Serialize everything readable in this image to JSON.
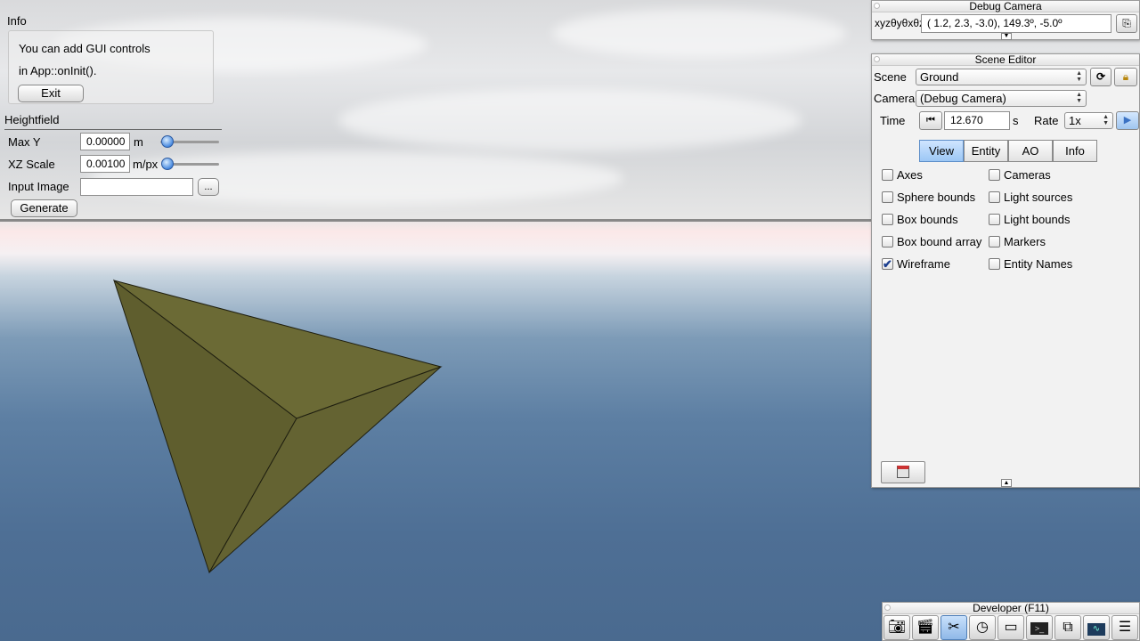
{
  "info_panel": {
    "title": "Info",
    "line1": "You can add GUI controls",
    "line2": "in App::onInit().",
    "exit_label": "Exit"
  },
  "heightfield_panel": {
    "title": "Heightfield",
    "max_y_label": "Max Y",
    "max_y_value": "0.00000",
    "max_y_unit": "m",
    "xz_scale_label": "XZ Scale",
    "xz_scale_value": "0.00100",
    "xz_scale_unit": "m/px",
    "input_image_label": "Input Image",
    "input_image_value": "",
    "browse_label": "...",
    "generate_label": "Generate"
  },
  "debug_camera": {
    "title": "Debug Camera",
    "coord_label": "xyzθyθxθz",
    "coord_value": "(  1.2,   2.3,  -3.0),  149.3º,  -5.0º"
  },
  "scene_editor": {
    "title": "Scene Editor",
    "scene_label": "Scene",
    "scene_value": "Ground",
    "camera_label": "Camera",
    "camera_value": "(Debug Camera)",
    "time_label": "Time",
    "time_value": "12.670",
    "time_unit": "s",
    "rate_label": "Rate",
    "rate_value": "1x",
    "tabs": [
      "View",
      "Entity",
      "AO",
      "Info"
    ],
    "active_tab": "View",
    "checkboxes_left": [
      {
        "label": "Axes",
        "checked": false
      },
      {
        "label": "Sphere bounds",
        "checked": false
      },
      {
        "label": "Box bounds",
        "checked": false
      },
      {
        "label": "Box bound array",
        "checked": false
      },
      {
        "label": "Wireframe",
        "checked": true
      }
    ],
    "checkboxes_right": [
      {
        "label": "Cameras",
        "checked": false
      },
      {
        "label": "Light sources",
        "checked": false
      },
      {
        "label": "Light bounds",
        "checked": false
      },
      {
        "label": "Markers",
        "checked": false
      },
      {
        "label": "Entity Names",
        "checked": false
      }
    ]
  },
  "developer": {
    "title": "Developer (F11)",
    "icons": [
      "camera-icon",
      "clapperboard-icon",
      "tools-icon",
      "clock-icon",
      "window-new-icon",
      "terminal-icon",
      "scene-windows-icon",
      "profiler-icon",
      "log-icon"
    ]
  },
  "colors": {
    "tetrahedron": "#6b6a35",
    "tab_active": "#9cc7f5",
    "sky_top": "#d9dadc",
    "water": "#4e6f95"
  }
}
